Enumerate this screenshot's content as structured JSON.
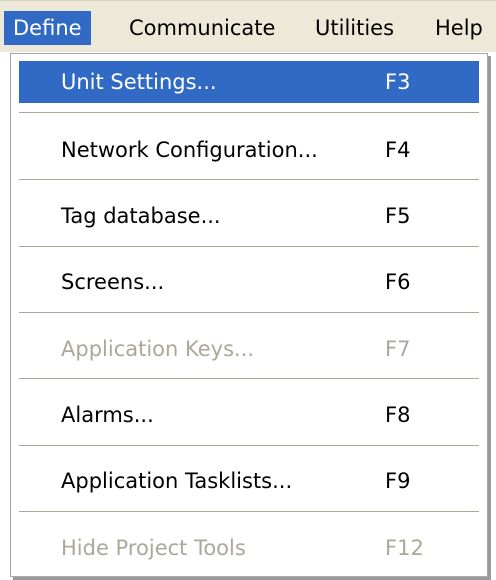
{
  "menubar": {
    "items": [
      {
        "label": "Define"
      },
      {
        "label": "Communicate"
      },
      {
        "label": "Utilities"
      },
      {
        "label": "Help"
      }
    ]
  },
  "dropdown": {
    "items": [
      {
        "label": "Unit Settings...",
        "shortcut": "F3",
        "state": "highlighted"
      },
      {
        "label": "Network Configuration...",
        "shortcut": "F4",
        "state": "enabled"
      },
      {
        "label": "Tag database...",
        "shortcut": "F5",
        "state": "enabled"
      },
      {
        "label": "Screens...",
        "shortcut": "F6",
        "state": "enabled"
      },
      {
        "label": "Application Keys...",
        "shortcut": "F7",
        "state": "disabled"
      },
      {
        "label": "Alarms...",
        "shortcut": "F8",
        "state": "enabled"
      },
      {
        "label": "Application Tasklists...",
        "shortcut": "F9",
        "state": "enabled"
      },
      {
        "label": "Hide Project Tools",
        "shortcut": "F12",
        "state": "disabled"
      }
    ]
  },
  "colors": {
    "highlight": "#316ac5",
    "menubar_background": "#ece9d8",
    "disabled_text": "#aca899",
    "separator": "#aca899"
  }
}
